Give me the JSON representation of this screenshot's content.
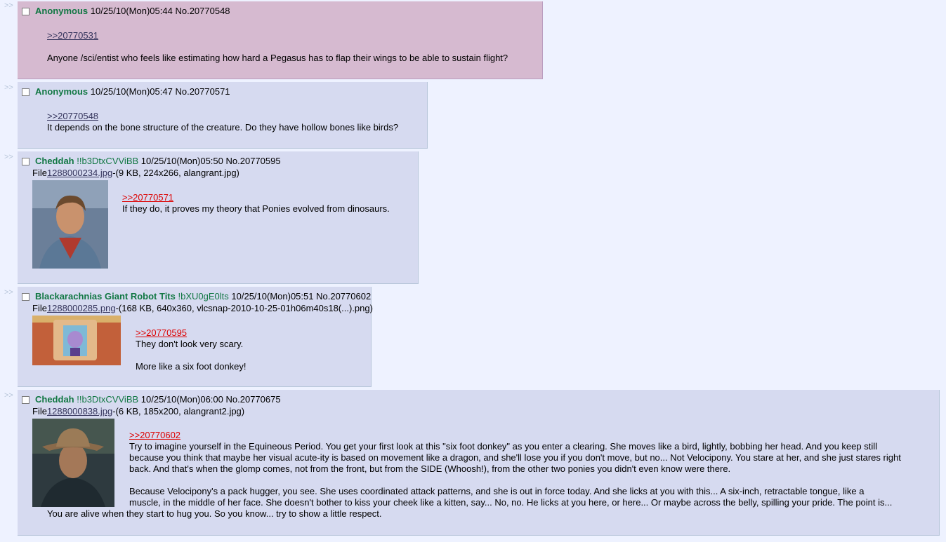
{
  "arrow": ">>",
  "file_label": "File",
  "posts": [
    {
      "name": "Anonymous",
      "trip": "",
      "datetime": "10/25/10(Mon)05:44",
      "number": "No.20770548",
      "quote": ">>20770531",
      "lines": [
        "Anyone /sci/entist who feels like estimating how hard a Pegasus has to flap their wings to be able to sustain flight?"
      ]
    },
    {
      "name": "Anonymous",
      "trip": "",
      "datetime": "10/25/10(Mon)05:47",
      "number": "No.20770571",
      "quote": ">>20770548",
      "lines": [
        "It depends on the bone structure of the creature. Do they have hollow bones like birds?"
      ]
    },
    {
      "name": "Cheddah",
      "trip": "!!b3DtxCVViBB",
      "datetime": "10/25/10(Mon)05:50",
      "number": "No.20770595",
      "file_name": "1288000234.jpg",
      "file_info": "-(9 KB, 224x266, alangrant.jpg)",
      "quote": ">>20770571",
      "lines": [
        "If they do, it proves my theory that Ponies evolved from dinosaurs."
      ]
    },
    {
      "name": "Blackarachnias Giant Robot Tits",
      "trip": "!bXU0gE0lts",
      "datetime": "10/25/10(Mon)05:51",
      "number": "No.20770602",
      "file_name": "1288000285.png",
      "file_info": "-(168 KB, 640x360, vlcsnap-2010-10-25-01h06m40s18(...).png)",
      "quote": ">>20770595",
      "lines": [
        "They don't look very scary.",
        "More like a six foot donkey!"
      ]
    },
    {
      "name": "Cheddah",
      "trip": "!!b3DtxCVViBB",
      "datetime": "10/25/10(Mon)06:00",
      "number": "No.20770675",
      "file_name": "1288000838.jpg",
      "file_info": "-(6 KB, 185x200, alangrant2.jpg)",
      "quote": ">>20770602",
      "p1": [
        "Try to imagine yourself in the Equineous Period. You get your first look at this \"six foot donkey\" as you enter a clearing. She moves like a bird, lightly, bobbing her head. And you keep still",
        "because you think that maybe her visual acute-ity is based on movement like a dragon, and she'll lose you if you don't move, but no... Not Velocipony. You stare at her, and she just stares right",
        "back. And that's when the glomp comes, not from the front, but from the SIDE (Whoosh!), from the other two ponies you didn't even know were there."
      ],
      "p2": [
        "Because Velocipony's a pack hugger, you see. She uses coordinated attack patterns, and she is out in force today. And she licks at you with this... A six-inch, retractable tongue, like a",
        "muscle, in the middle of her face. She doesn't bother to kiss your cheek like a kitten, say... No, no. He licks at you here, or here... Or maybe across the belly, spilling your pride. The point is...",
        "You are alive when they start to hug you. So you know... try to show a little respect."
      ]
    }
  ]
}
